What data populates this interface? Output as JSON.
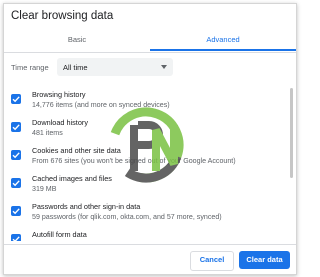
{
  "dialog": {
    "title": "Clear browsing data",
    "tabs": [
      {
        "label": "Basic",
        "selected": false
      },
      {
        "label": "Advanced",
        "selected": true
      }
    ],
    "time_range": {
      "label": "Time range",
      "value": "All time"
    },
    "items": [
      {
        "title": "Browsing history",
        "subtitle": "14,776 items (and more on synced devices)",
        "checked": true
      },
      {
        "title": "Download history",
        "subtitle": "481 items",
        "checked": true
      },
      {
        "title": "Cookies and other site data",
        "subtitle": "From 676 sites (you won't be signed out of your Google Account)",
        "checked": true
      },
      {
        "title": "Cached images and files",
        "subtitle": "319 MB",
        "checked": true
      },
      {
        "title": "Passwords and other sign-in data",
        "subtitle": "59 passwords (for qlik.com, okta.com, and 57 more, synced)",
        "checked": true
      },
      {
        "title": "Autofill form data",
        "subtitle": "",
        "checked": true
      }
    ],
    "buttons": {
      "cancel": "Cancel",
      "clear": "Clear data"
    }
  },
  "colors": {
    "accent": "#1a73e8",
    "watermark_dark": "#4a4a4a",
    "watermark_green": "#7ac143"
  },
  "watermark": {
    "icon": "pn-logo-watermark"
  }
}
